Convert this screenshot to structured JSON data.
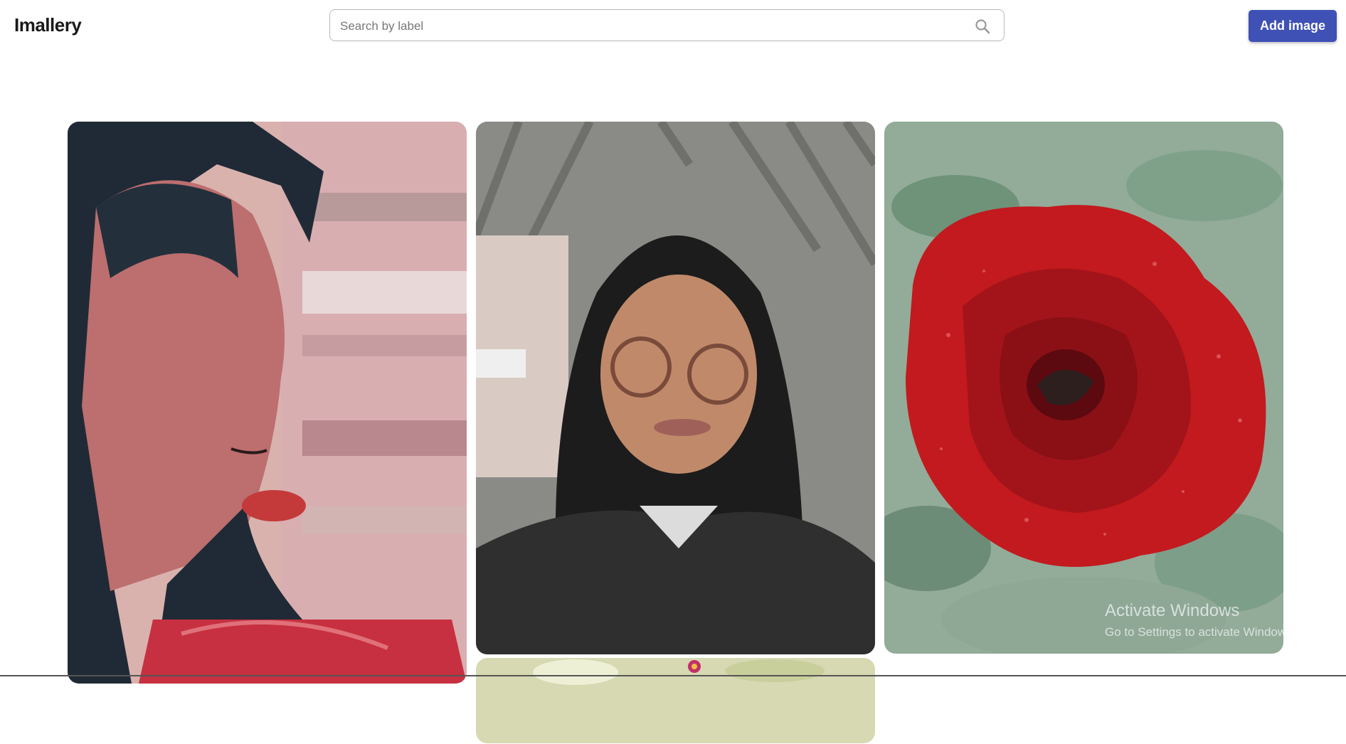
{
  "app": {
    "title": "Imallery"
  },
  "search": {
    "placeholder": "Search by label",
    "value": "",
    "icon": "search-icon"
  },
  "toolbar": {
    "add_label": "Add image"
  },
  "gallery": {
    "items": [
      {
        "id": "portrait-profile"
      },
      {
        "id": "portrait-selfie"
      },
      {
        "id": "red-rose"
      },
      {
        "id": "flowers"
      },
      {
        "id": "partial"
      }
    ]
  },
  "watermark": {
    "line1": "Activate Windows",
    "line2": "Go to Settings to activate Windows."
  },
  "colors": {
    "accent": "#3f51b5"
  }
}
